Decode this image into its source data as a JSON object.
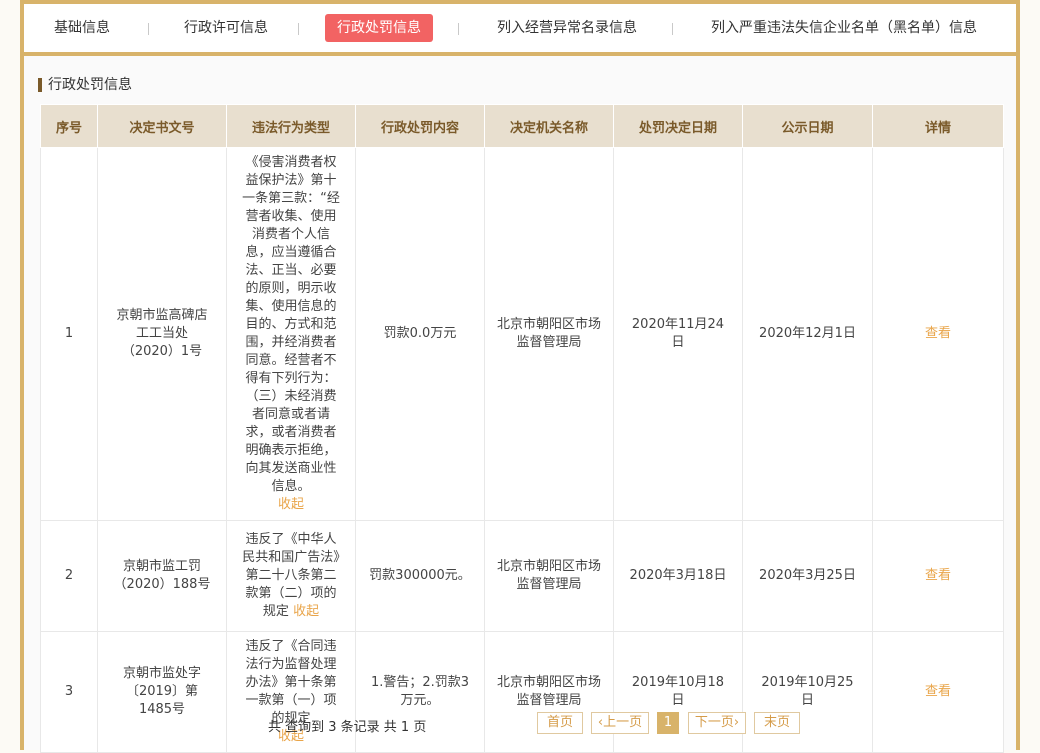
{
  "tabs": [
    {
      "label": "基础信息"
    },
    {
      "label": "行政许可信息"
    },
    {
      "label": "行政处罚信息"
    },
    {
      "label": "列入经营异常名录信息"
    },
    {
      "label": "列入严重违法失信企业名单（黑名单）信息"
    }
  ],
  "section": {
    "title": "行政处罚信息"
  },
  "table": {
    "headers": [
      "序号",
      "决定书文号",
      "违法行为类型",
      "行政处罚内容",
      "决定机关名称",
      "处罚决定日期",
      "公示日期",
      "详情"
    ],
    "rows": [
      {
        "no": "1",
        "doc": "京朝市监高碑店工工当处（2020）1号",
        "violation": "《侵害消费者权益保护法》第十一条第三款：“经营者收集、使用消费者个人信息，应当遵循合法、正当、必要的原则，明示收集、使用信息的目的、方式和范围，并经消费者同意。经营者不得有下列行为：（三）未经消费者同意或者请求，或者消费者明确表示拒绝，向其发送商业性信息。",
        "collapse": "收起",
        "penalty": "罚款0.0万元",
        "org": "北京市朝阳区市场监督管理局",
        "decision_date": "2020年11月24日",
        "publish_date": "2020年12月1日",
        "detail": "查看"
      },
      {
        "no": "2",
        "doc": "京朝市监工罚（2020）188号",
        "violation": "违反了《中华人民共和国广告法》第二十八条第二款第（二）项的规定",
        "collapse": "收起",
        "penalty": "罚款300000元。",
        "org": "北京市朝阳区市场监督管理局",
        "decision_date": "2020年3月18日",
        "publish_date": "2020年3月25日",
        "detail": "查看"
      },
      {
        "no": "3",
        "doc": "京朝市监处字〔2019〕第1485号",
        "violation": "违反了《合同违法行为监督处理办法》第十条第一款第（一）项的规定",
        "collapse": "收起",
        "penalty": "1.警告；2.罚款3万元。",
        "org": "北京市朝阳区市场监督管理局",
        "decision_date": "2019年10月18日",
        "publish_date": "2019年10月25日",
        "detail": "查看"
      }
    ]
  },
  "footer": {
    "summary": "共 查询到 3 条记录 共 1 页",
    "first": "首页",
    "prev": "‹上一页",
    "page": "1",
    "next": "下一页›",
    "last": "末页"
  }
}
